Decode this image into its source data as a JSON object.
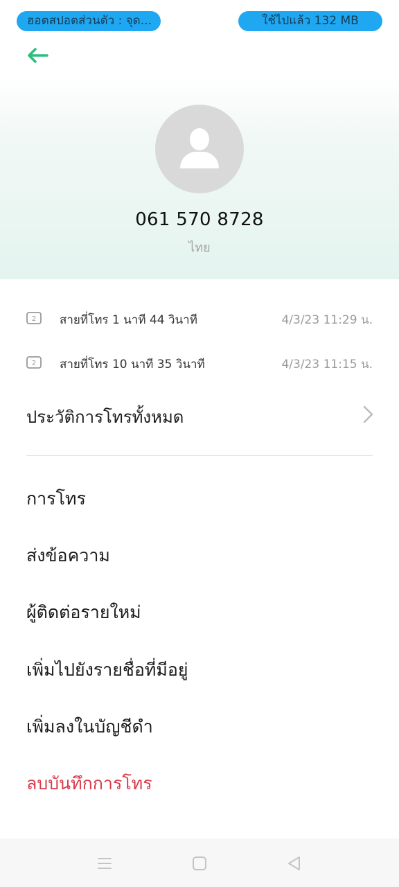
{
  "status_bar": {
    "left_pill": "ฮอตสปอตส่วนตัว : จุด...",
    "right_pill": "ใช้ไปแล้ว 132 MB"
  },
  "contact": {
    "phone_number": "061 570 8728",
    "region": "ไทย"
  },
  "call_log": [
    {
      "duration": "สายที่โทร  1  นาที 44 วินาที",
      "datetime": "4/3/23 11:29 น."
    },
    {
      "duration": "สายที่โทร  10  นาที 35 วินาที",
      "datetime": "4/3/23 11:15 น."
    }
  ],
  "history_link": "ประวัติการโทรทั้งหมด",
  "actions": {
    "call": "การโทร",
    "message": "ส่งข้อความ",
    "new_contact": "ผู้ติดต่อรายใหม่",
    "add_existing": "เพิ่มไปยังรายชื่อที่มีอยู่",
    "blacklist": "เพิ่มลงในบัญชีดำ",
    "delete_log": "ลบบันทึกการโทร"
  },
  "icons": {
    "back": "arrow-left-icon",
    "avatar": "person-icon",
    "sim": "sim2-icon",
    "chevron": "chevron-right-icon",
    "nav_menu": "menu-icon",
    "nav_home": "home-icon",
    "nav_back": "back-triangle-icon"
  },
  "colors": {
    "accent": "#2bbf7e",
    "status_pill": "#1fa7f2",
    "danger": "#d83b4c"
  }
}
